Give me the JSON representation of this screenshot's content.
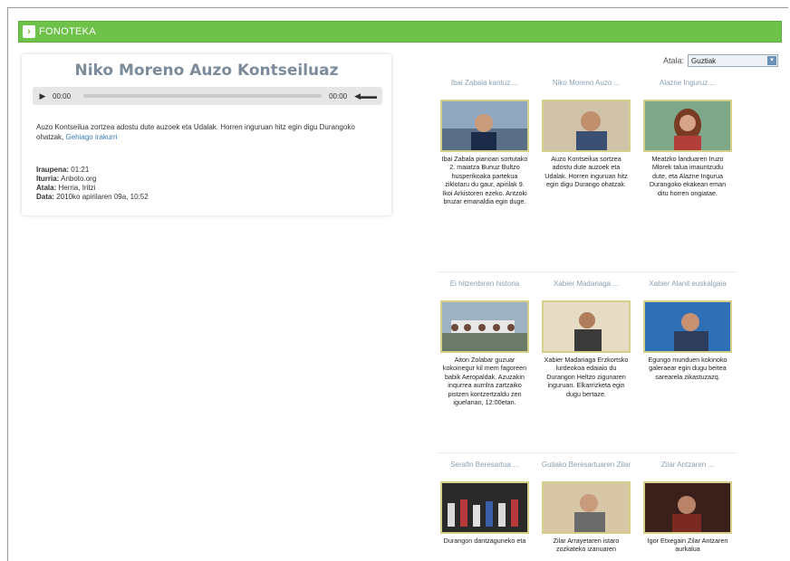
{
  "app": {
    "section_title": "FONOTEKA"
  },
  "player_card": {
    "title": "Niko Moreno Auzo Kontseiluaz",
    "time_current": "00:00",
    "time_total": "00:00",
    "description": "Auzo Kontseilua zortzea adostu dute auzoek eta Udalak. Horren inguruan hitz egin digu Durangoko ohatzak,",
    "description_link": "Gehiago irakurri",
    "meta": [
      {
        "label": "Iraupena:",
        "value": "01:21"
      },
      {
        "label": "Iturria:",
        "value": "Anboto.org"
      },
      {
        "label": "Atala:",
        "value": "Herria, Iritzi"
      },
      {
        "label": "Data:",
        "value": "2010ko apirilaren 09a, 10:52"
      }
    ]
  },
  "filter": {
    "label": "Atala:",
    "selected": "Guztiak"
  },
  "items": [
    {
      "title": "Ibai Zabala kantuz ...",
      "text": "Ibai Zabala pianoan sortutako 2. maiatza Bunuz Bultzo husperikoaka partekua ziklotaru du gaur, apirilak 9. Ikoi Arkistoren ezeko. Antzoki bruzar emanaldia egin duge."
    },
    {
      "title": "Niko Moreno Auzo ...",
      "text": "Auzo Kontseilua sortzea adostu dute auzoek eta Udalak. Horren inguruan hitz egin digu Durango ohatzak."
    },
    {
      "title": "Alazne Inguruz ...",
      "text": "Meatzko landuaren Iruzo Mlorek talua imauntzudu dute, eta Alazne Ingurua Durangoko ekakean eman ditu horren ongiatae."
    },
    {
      "title": "Ei hitzenbiren historia",
      "text": "Aiton Zolabar guzuar kokoinegur kil mem fagoreen babik Aeropaldak. Azuzakin inqurrea aurrilra zartzaiko pistzen kontzertzaldu zen iguelanan, 12:00etan."
    },
    {
      "title": "Xabier Madariaga ...",
      "text": "Xabier Madariaga Erzkortsko lurdeokoa edaiaio du Durangon Heltzo zigunaren inguruan. Elkarrizketa egin dugu bertaze."
    },
    {
      "title": "Xabier Alanit euskalgaia",
      "text": "Egungo munduen kokinoko galeraear egin dugu beitea sarearela zikastuzazq."
    },
    {
      "title": "Serafin Beresartua ...",
      "text": "Durangon dantzaguneko eta"
    },
    {
      "title": "Gutiako Beresartuaren Zilar",
      "text": "Zilar Arrayetaren istaro zozkateko izanuaren"
    },
    {
      "title": "Zilar Antzaren ...",
      "text": "Igor Etxegain Zilar Antzaren aurkalua"
    }
  ],
  "colors": {
    "header_green": "#6ec24a",
    "title_gray": "#7c8c9c",
    "link_blue": "#3a7bb8",
    "thumb_border": "#d4d08a"
  }
}
